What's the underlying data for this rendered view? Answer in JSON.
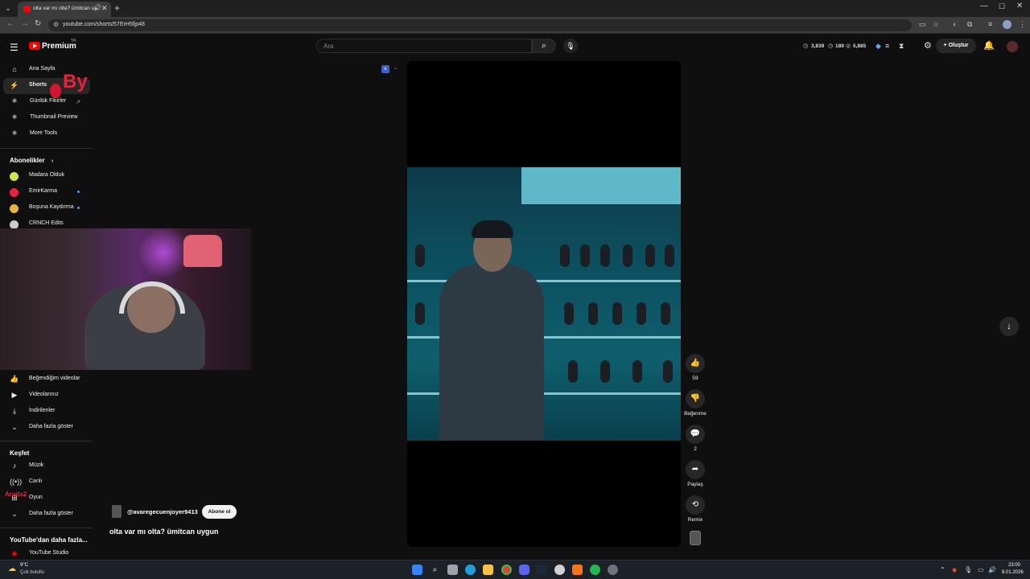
{
  "browser": {
    "tab_title": "olta var mı olta? ümitcan uy",
    "url": "youtube.com/shorts/57ErH5fjp48",
    "new_tab_glyph": "+",
    "tab_close_glyph": "✕"
  },
  "header": {
    "brand": "Premium",
    "country_code": "TR",
    "search_placeholder": "Ara",
    "stats": [
      "3,839",
      "189",
      "5,885"
    ],
    "create_label": "Oluştur"
  },
  "sidebar": {
    "main_items": [
      {
        "label": "Ana Sayfa",
        "icon": "home-icon"
      },
      {
        "label": "Shorts",
        "icon": "shorts-icon"
      },
      {
        "label": "Günlük Fikirler",
        "icon": "tool-icon"
      },
      {
        "label": "Thumbnail Preview",
        "icon": "tool-icon"
      },
      {
        "label": "More Tools",
        "icon": "tool-icon"
      }
    ],
    "subscriptions_heading": "Abonelikler",
    "subscriptions": [
      {
        "label": "Madara Olduk",
        "color": "#c9e84c"
      },
      {
        "label": "EmirKarma",
        "color": "#e8213c"
      },
      {
        "label": "Boşuna Kaydırma",
        "color": "#e8b33c"
      },
      {
        "label": "CRNCH Edits",
        "color": "#cccccc"
      }
    ],
    "you_items": [
      {
        "label": "Beğendiğim videolar"
      },
      {
        "label": "Videolarınız"
      },
      {
        "label": "İndirilenler"
      },
      {
        "label": "Daha fazla göster"
      }
    ],
    "explore_heading": "Keşfet",
    "explore_items": [
      {
        "label": "Müzik"
      },
      {
        "label": "Canlı"
      },
      {
        "label": "Oyun"
      },
      {
        "label": "Daha fazla göster"
      }
    ],
    "more_heading": "YouTube'dan daha fazla...",
    "more_items": [
      {
        "label": "YouTube Studio"
      }
    ]
  },
  "overlay": {
    "by_text": "By",
    "arada_text": "Arada2"
  },
  "short": {
    "channel": "@avaregecuenjoyer9413",
    "subscribe_label": "Abone ol",
    "title": "olta var mı olta? ümitcan uygun",
    "likes": "59",
    "dislike_label": "Beğenme",
    "comments": "2",
    "share_label": "Paylaş",
    "remix_label": "Remix",
    "lang_badge": "tr"
  },
  "taskbar": {
    "weather_temp": "9°C",
    "weather_desc": "Çok bulutlu",
    "time": "23:00",
    "date": "8.01.2026"
  },
  "colors": {
    "accent_red": "#ff0000",
    "background": "#0f0f0f",
    "surface": "#272727"
  }
}
